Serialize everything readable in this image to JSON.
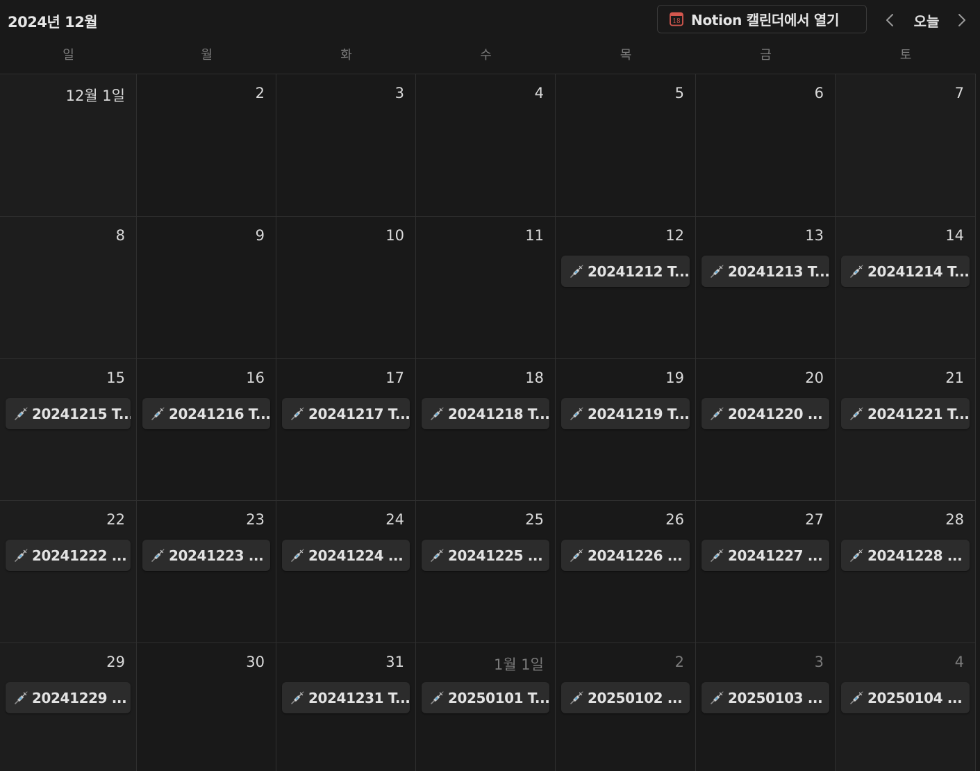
{
  "header": {
    "month_title": "2024년 12월",
    "open_calendar_label": "Notion 캘린더에서 열기",
    "calendar_icon_day": "18",
    "today_label": "오늘"
  },
  "weekdays": [
    "일",
    "월",
    "화",
    "수",
    "목",
    "금",
    "토"
  ],
  "weeks": [
    [
      {
        "label": "12월 1일",
        "other": false,
        "event": null
      },
      {
        "label": "2",
        "other": false,
        "event": null
      },
      {
        "label": "3",
        "other": false,
        "event": null
      },
      {
        "label": "4",
        "other": false,
        "event": null
      },
      {
        "label": "5",
        "other": false,
        "event": null
      },
      {
        "label": "6",
        "other": false,
        "event": null
      },
      {
        "label": "7",
        "other": false,
        "event": null
      }
    ],
    [
      {
        "label": "8",
        "other": false,
        "event": null
      },
      {
        "label": "9",
        "other": false,
        "event": null
      },
      {
        "label": "10",
        "other": false,
        "event": null
      },
      {
        "label": "11",
        "other": false,
        "event": null
      },
      {
        "label": "12",
        "other": false,
        "event": "20241212 T..."
      },
      {
        "label": "13",
        "other": false,
        "event": "20241213 T..."
      },
      {
        "label": "14",
        "other": false,
        "event": "20241214 T..."
      }
    ],
    [
      {
        "label": "15",
        "other": false,
        "event": "20241215 T..."
      },
      {
        "label": "16",
        "other": false,
        "event": "20241216 T..."
      },
      {
        "label": "17",
        "other": false,
        "event": "20241217 T..."
      },
      {
        "label": "18",
        "other": false,
        "event": "20241218 T..."
      },
      {
        "label": "19",
        "other": false,
        "event": "20241219 T..."
      },
      {
        "label": "20",
        "other": false,
        "event": "20241220 ..."
      },
      {
        "label": "21",
        "other": false,
        "event": "20241221 T..."
      }
    ],
    [
      {
        "label": "22",
        "other": false,
        "event": "20241222 ..."
      },
      {
        "label": "23",
        "other": false,
        "event": "20241223 ..."
      },
      {
        "label": "24",
        "other": false,
        "event": "20241224 ..."
      },
      {
        "label": "25",
        "other": false,
        "event": "20241225 ..."
      },
      {
        "label": "26",
        "other": false,
        "event": "20241226 ..."
      },
      {
        "label": "27",
        "other": false,
        "event": "20241227 ..."
      },
      {
        "label": "28",
        "other": false,
        "event": "20241228 ..."
      }
    ],
    [
      {
        "label": "29",
        "other": false,
        "event": "20241229 ..."
      },
      {
        "label": "30",
        "other": false,
        "event": null
      },
      {
        "label": "31",
        "other": false,
        "event": "20241231 T..."
      },
      {
        "label": "1월 1일",
        "other": true,
        "event": "20250101 T..."
      },
      {
        "label": "2",
        "other": true,
        "event": "20250102 ..."
      },
      {
        "label": "3",
        "other": true,
        "event": "20250103 ..."
      },
      {
        "label": "4",
        "other": true,
        "event": "20250104 ..."
      }
    ]
  ],
  "icons": {
    "event_icon": "syringe-icon",
    "calendar_icon": "calendar-icon",
    "prev_icon": "chevron-left-icon",
    "next_icon": "chevron-right-icon"
  },
  "colors": {
    "background": "#191919",
    "weekend_background": "#1d1d1d",
    "event_background": "#2c2c2c",
    "calendar_icon_red": "#d4574e"
  }
}
